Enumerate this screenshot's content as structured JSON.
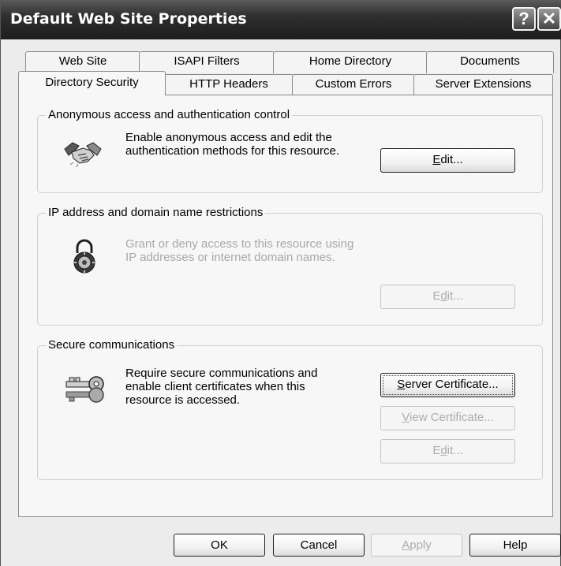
{
  "window": {
    "title": "Default Web Site Properties",
    "help_glyph": "?",
    "close_glyph": "✕"
  },
  "tabs_row1": [
    "Web Site",
    "ISAPI Filters",
    "Home Directory",
    "Documents"
  ],
  "tabs_row2": [
    "Directory Security",
    "HTTP Headers",
    "Custom Errors",
    "Server Extensions"
  ],
  "active_tab": "Directory Security",
  "groups": {
    "anonymous": {
      "legend": "Anonymous access and authentication control",
      "desc": [
        "Enable anonymous access and edit the",
        "authentication methods for this resource."
      ],
      "icon": "handshake-icon",
      "button": {
        "pre": "",
        "accel": "E",
        "post": "dit..."
      }
    },
    "ip": {
      "legend": "IP address and domain name restrictions",
      "desc": [
        "Grant or deny access to this resource using",
        "IP addresses or internet domain names."
      ],
      "icon": "padlock-icon",
      "button": {
        "pre": "E",
        "accel": "d",
        "post": "it..."
      }
    },
    "secure": {
      "legend": "Secure communications",
      "desc": [
        "Require secure communications and",
        "enable client certificates when this",
        "resource is accessed."
      ],
      "icon": "key-icon",
      "buttons": {
        "server_cert": {
          "pre": "",
          "accel": "S",
          "post": "erver Certificate..."
        },
        "view_cert": {
          "pre": "",
          "accel": "V",
          "post": "iew Certificate..."
        },
        "edit": {
          "pre": "E",
          "accel": "d",
          "post": "it..."
        }
      }
    }
  },
  "footer": {
    "ok": "OK",
    "cancel": "Cancel",
    "apply": {
      "pre": "",
      "accel": "A",
      "post": "pply"
    },
    "help": "Help"
  }
}
